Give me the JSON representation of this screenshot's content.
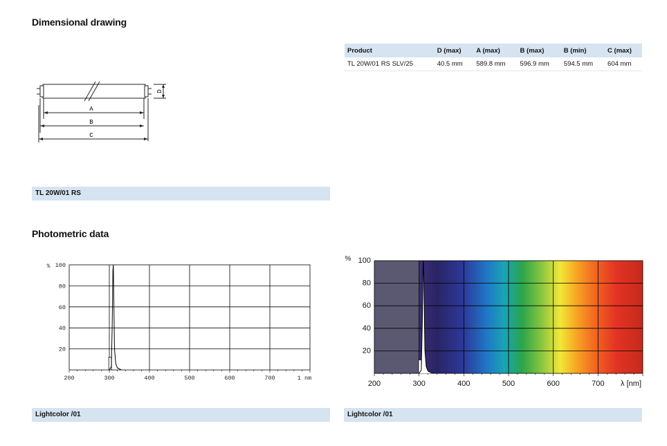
{
  "sections": {
    "dimensional_title": "Dimensional drawing",
    "photometric_title": "Photometric data"
  },
  "drawing_labels": {
    "a": "A",
    "b": "B",
    "c": "C",
    "d": "D"
  },
  "product_table": {
    "headers": [
      "Product",
      "D (max)",
      "A (max)",
      "B (max)",
      "B (min)",
      "C (max)"
    ],
    "rows": [
      [
        "TL 20W/01 RS SLV/25",
        "40.5 mm",
        "589.8 mm",
        "596.9 mm",
        "594.5 mm",
        "604 mm"
      ]
    ]
  },
  "product_bar": "TL 20W/01 RS",
  "captions": {
    "left": "Lightcolor /01",
    "right": "Lightcolor /01"
  },
  "chart_data": [
    {
      "type": "line",
      "ylabel": "%",
      "xlabel": "",
      "x_unit_label": "nm",
      "x_ticks": [
        200,
        300,
        400,
        500,
        600,
        700
      ],
      "x_tick_labels": [
        "200",
        "300",
        "400",
        "500",
        "600",
        "700",
        "1 nm"
      ],
      "y_ticks": [
        20,
        40,
        60,
        80,
        100
      ],
      "y_tick_labels": [
        "20",
        "40",
        "60",
        "80",
        "100"
      ],
      "xlim": [
        200,
        800
      ],
      "ylim": [
        0,
        100
      ],
      "grid": true,
      "series": [
        {
          "x": [
            300,
            305,
            307,
            309,
            310,
            311,
            313,
            316,
            320,
            325,
            330
          ],
          "y": [
            0,
            3,
            40,
            95,
            100,
            70,
            20,
            6,
            2,
            1,
            0
          ]
        }
      ],
      "mercury_line": {
        "x": 302,
        "y": 12
      }
    },
    {
      "type": "line",
      "ylabel": "%",
      "xlabel": "λ [nm]",
      "x_ticks": [
        200,
        300,
        400,
        500,
        600,
        700
      ],
      "x_tick_labels": [
        "200",
        "300",
        "400",
        "500",
        "600",
        "700"
      ],
      "y_ticks": [
        20,
        40,
        60,
        80,
        100
      ],
      "y_tick_labels": [
        "20",
        "40",
        "60",
        "80",
        "100"
      ],
      "xlim": [
        200,
        800
      ],
      "ylim": [
        0,
        100
      ],
      "grid": true,
      "background": "visible spectrum gradient",
      "series": [
        {
          "x": [
            300,
            305,
            307,
            309,
            310,
            311,
            313,
            316,
            320,
            325,
            330
          ],
          "y": [
            0,
            3,
            40,
            95,
            100,
            70,
            20,
            6,
            2,
            1,
            0
          ]
        }
      ],
      "mercury_line": {
        "x": 302,
        "y": 12
      }
    }
  ],
  "colors": {
    "bar_bg": "#d6e3f0",
    "uv_grey": "#5b5872",
    "violet": "#3b2f73",
    "red": "#d42a1c"
  }
}
